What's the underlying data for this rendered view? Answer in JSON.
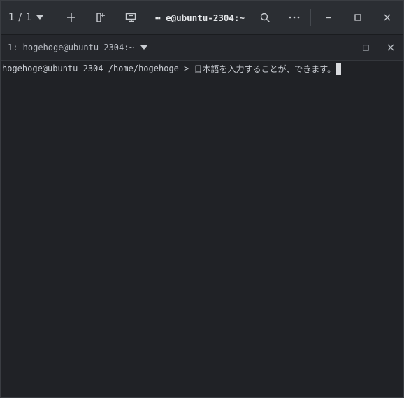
{
  "titlebar": {
    "counter": "1 / 1",
    "title": "⋯ e@ubuntu-2304:~",
    "icons": [
      "chevron-down-icon",
      "plus-icon",
      "split-icon",
      "broadcast-icon",
      "search-icon",
      "ellipsis-icon",
      "minimize-icon",
      "maximize-icon",
      "close-icon"
    ]
  },
  "tab": {
    "label": "1: hogehoge@ubuntu-2304:~"
  },
  "terminal": {
    "prompt": "hogehoge@ubuntu-2304 /home/hogehoge > ",
    "input": "日本語を入力することが、できます。"
  },
  "colors": {
    "titlebar_bg": "#2b2e33",
    "terminal_bg": "#202226",
    "text": "#c8ccd2"
  }
}
